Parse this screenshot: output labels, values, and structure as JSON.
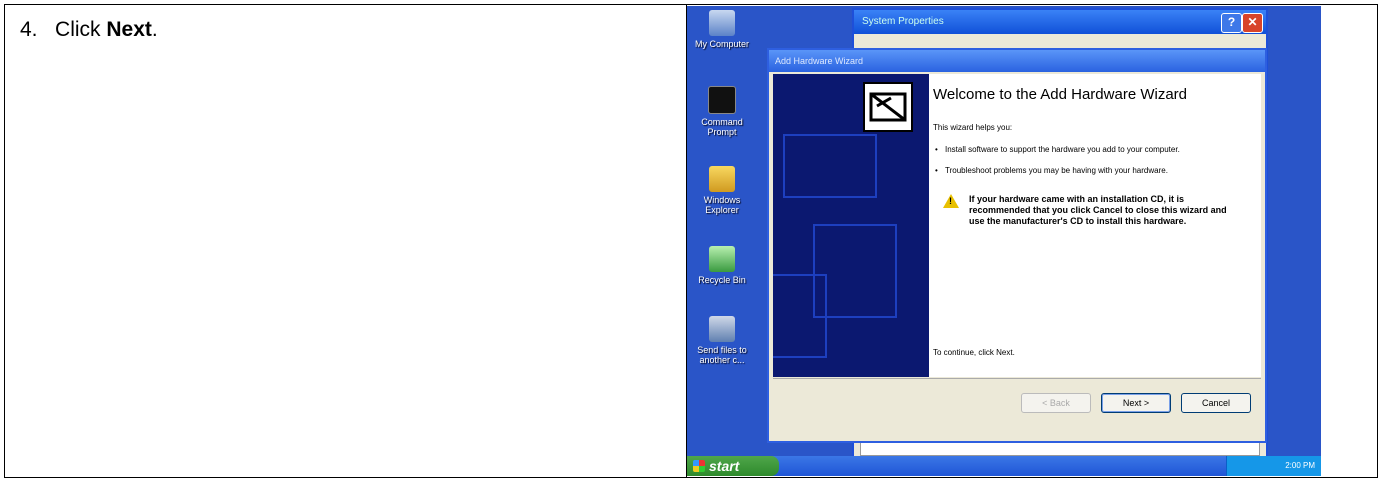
{
  "step": {
    "number": "4.",
    "prefix": "Click ",
    "bold": "Next",
    "suffix": "."
  },
  "desktop": {
    "icons": [
      {
        "label": "My Computer"
      },
      {
        "label": "Command Prompt"
      },
      {
        "label": "Windows Explorer"
      },
      {
        "label": "Recycle Bin"
      },
      {
        "label": "Send files to another c..."
      }
    ]
  },
  "system_properties": {
    "title": "System Properties",
    "help": "?",
    "close": "✕"
  },
  "wizard": {
    "title": "Add Hardware Wizard",
    "heading": "Welcome to the Add Hardware Wizard",
    "intro": "This wizard helps you:",
    "bullets": [
      "Install software to support the hardware you add to your computer.",
      "Troubleshoot problems you may be having with your hardware."
    ],
    "warning": "If your hardware came with an installation CD, it is recommended that you click Cancel to close this wizard and use the manufacturer's CD to install this hardware.",
    "continue": "To continue, click Next.",
    "buttons": {
      "back": "< Back",
      "next": "Next >",
      "cancel": "Cancel"
    }
  },
  "taskbar": {
    "start": "start",
    "clock": "2:00 PM"
  },
  "colors": {
    "desktop": "#2a55c8",
    "titlebar": "#1050d8",
    "start": "#2e8a2c"
  }
}
